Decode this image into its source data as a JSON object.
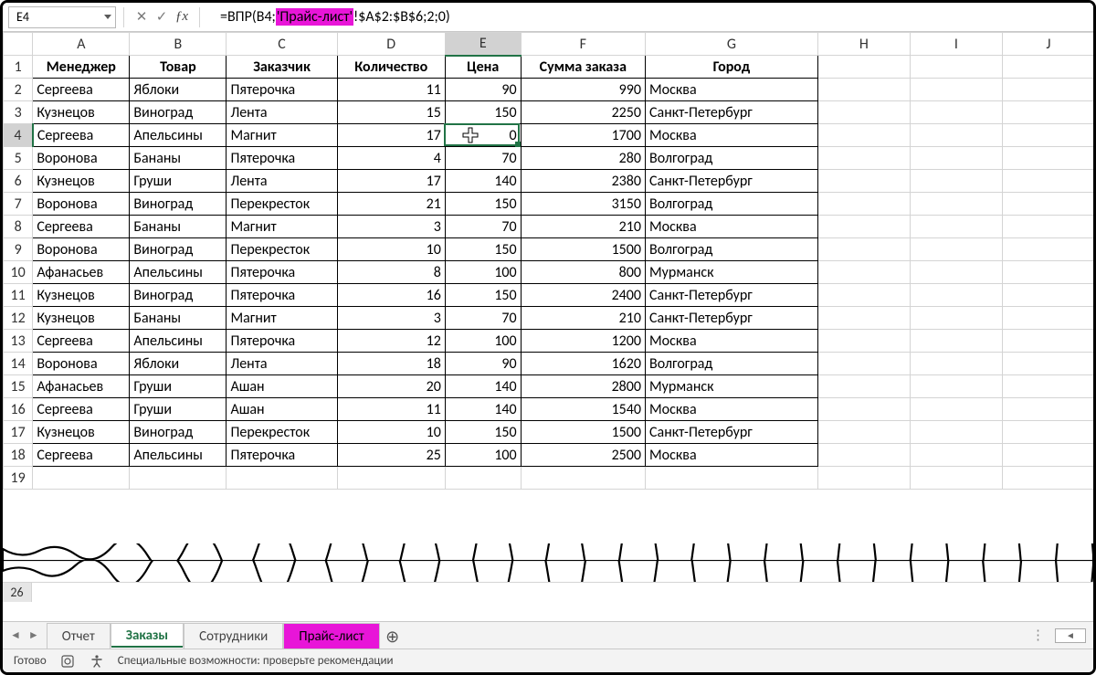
{
  "namebox": {
    "value": "E4"
  },
  "formula": {
    "prefix": "=ВПР(B4;",
    "highlighted": "'Прайс-лист'",
    "suffix": "!$A$2:$B$6;2;0)"
  },
  "columns": [
    "A",
    "B",
    "C",
    "D",
    "E",
    "F",
    "G",
    "H",
    "I",
    "J"
  ],
  "headers": {
    "A": "Менеджер",
    "B": "Товар",
    "C": "Заказчик",
    "D": "Количество",
    "E": "Цена",
    "F": "Сумма заказа",
    "G": "Город"
  },
  "rows": [
    {
      "n": 2,
      "A": "Сергеева",
      "B": "Яблоки",
      "C": "Пятерочка",
      "D": 11,
      "E": 90,
      "F": 990,
      "G": "Москва"
    },
    {
      "n": 3,
      "A": "Кузнецов",
      "B": "Виноград",
      "C": "Лента",
      "D": 15,
      "E": 150,
      "F": 2250,
      "G": "Санкт-Петербург"
    },
    {
      "n": 4,
      "A": "Сергеева",
      "B": "Апельсины",
      "C": "Магнит",
      "D": 17,
      "E": "0",
      "F": 1700,
      "G": "Москва"
    },
    {
      "n": 5,
      "A": "Воронова",
      "B": "Бананы",
      "C": "Пятерочка",
      "D": 4,
      "E": 70,
      "F": 280,
      "G": "Волгоград"
    },
    {
      "n": 6,
      "A": "Кузнецов",
      "B": "Груши",
      "C": "Лента",
      "D": 17,
      "E": 140,
      "F": 2380,
      "G": "Санкт-Петербург"
    },
    {
      "n": 7,
      "A": "Воронова",
      "B": "Виноград",
      "C": "Перекресток",
      "D": 21,
      "E": 150,
      "F": 3150,
      "G": "Волгоград"
    },
    {
      "n": 8,
      "A": "Сергеева",
      "B": "Бананы",
      "C": "Магнит",
      "D": 3,
      "E": 70,
      "F": 210,
      "G": "Москва"
    },
    {
      "n": 9,
      "A": "Воронова",
      "B": "Виноград",
      "C": "Перекресток",
      "D": 10,
      "E": 150,
      "F": 1500,
      "G": "Волгоград"
    },
    {
      "n": 10,
      "A": "Афанасьев",
      "B": "Апельсины",
      "C": "Пятерочка",
      "D": 8,
      "E": 100,
      "F": 800,
      "G": "Мурманск"
    },
    {
      "n": 11,
      "A": "Кузнецов",
      "B": "Виноград",
      "C": "Пятерочка",
      "D": 16,
      "E": 150,
      "F": 2400,
      "G": "Санкт-Петербург"
    },
    {
      "n": 12,
      "A": "Кузнецов",
      "B": "Бананы",
      "C": "Магнит",
      "D": 3,
      "E": 70,
      "F": 210,
      "G": "Санкт-Петербург"
    },
    {
      "n": 13,
      "A": "Сергеева",
      "B": "Апельсины",
      "C": "Пятерочка",
      "D": 12,
      "E": 100,
      "F": 1200,
      "G": "Москва"
    },
    {
      "n": 14,
      "A": "Воронова",
      "B": "Яблоки",
      "C": "Лента",
      "D": 18,
      "E": 90,
      "F": 1620,
      "G": "Волгоград"
    },
    {
      "n": 15,
      "A": "Афанасьев",
      "B": "Груши",
      "C": "Ашан",
      "D": 20,
      "E": 140,
      "F": 2800,
      "G": "Мурманск"
    },
    {
      "n": 16,
      "A": "Сергеева",
      "B": "Груши",
      "C": "Ашан",
      "D": 11,
      "E": 140,
      "F": 1540,
      "G": "Москва"
    },
    {
      "n": 17,
      "A": "Кузнецов",
      "B": "Виноград",
      "C": "Перекресток",
      "D": 10,
      "E": 150,
      "F": 1500,
      "G": "Санкт-Петербург"
    },
    {
      "n": 18,
      "A": "Сергеева",
      "B": "Апельсины",
      "C": "Пятерочка",
      "D": 25,
      "E": 100,
      "F": 2500,
      "G": "Москва"
    }
  ],
  "row26_label": "26",
  "sheet_tabs": {
    "items": [
      "Отчет",
      "Заказы",
      "Сотрудники",
      "Прайс-лист"
    ],
    "active_index": 1,
    "highlight_index": 3
  },
  "status": {
    "ready": "Готово",
    "accessibility": "Специальные возможности: проверьте рекомендации"
  },
  "active_cell": {
    "row": 4,
    "col": "E"
  }
}
